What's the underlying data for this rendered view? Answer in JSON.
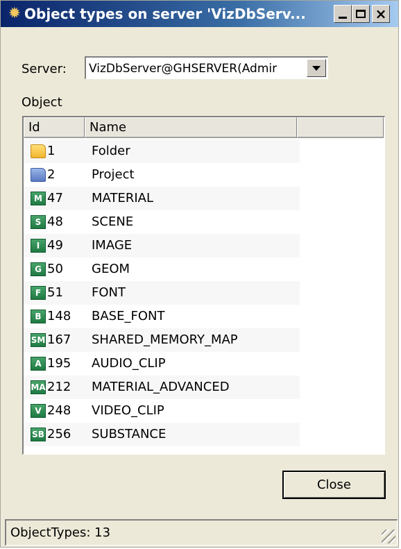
{
  "window": {
    "title": "Object types on server 'VizDbServ..."
  },
  "server": {
    "label": "Server:",
    "value": "VizDbServer@GHSERVER(Admir"
  },
  "object_group_label": "Object",
  "columns": [
    "Id",
    "Name"
  ],
  "rows": [
    {
      "id": "1",
      "name": "Folder",
      "icon": "folder-icon",
      "badge": ""
    },
    {
      "id": "2",
      "name": "Project",
      "icon": "project-folder-icon",
      "badge": ""
    },
    {
      "id": "47",
      "name": "MATERIAL",
      "icon": "material-icon",
      "badge": "M"
    },
    {
      "id": "48",
      "name": "SCENE",
      "icon": "scene-icon",
      "badge": "S"
    },
    {
      "id": "49",
      "name": "IMAGE",
      "icon": "image-icon",
      "badge": "I"
    },
    {
      "id": "50",
      "name": "GEOM",
      "icon": "geom-icon",
      "badge": "G"
    },
    {
      "id": "51",
      "name": "FONT",
      "icon": "font-icon",
      "badge": "F"
    },
    {
      "id": "148",
      "name": "BASE_FONT",
      "icon": "base-font-icon",
      "badge": "B"
    },
    {
      "id": "167",
      "name": "SHARED_MEMORY_MAP",
      "icon": "shared-memory-map-icon",
      "badge": "SM"
    },
    {
      "id": "195",
      "name": "AUDIO_CLIP",
      "icon": "audio-clip-icon",
      "badge": "A"
    },
    {
      "id": "212",
      "name": "MATERIAL_ADVANCED",
      "icon": "material-advanced-icon",
      "badge": "MA"
    },
    {
      "id": "248",
      "name": "VIDEO_CLIP",
      "icon": "video-clip-icon",
      "badge": "V"
    },
    {
      "id": "256",
      "name": "SUBSTANCE",
      "icon": "substance-icon",
      "badge": "SB"
    }
  ],
  "buttons": {
    "close": "Close"
  },
  "status": {
    "text": "ObjectTypes: 13"
  },
  "colors": {
    "titlebar_start": "#0a246a",
    "titlebar_end": "#a6caf0",
    "badge_green": "#1f7a43",
    "window_bg": "#ece9d8"
  }
}
